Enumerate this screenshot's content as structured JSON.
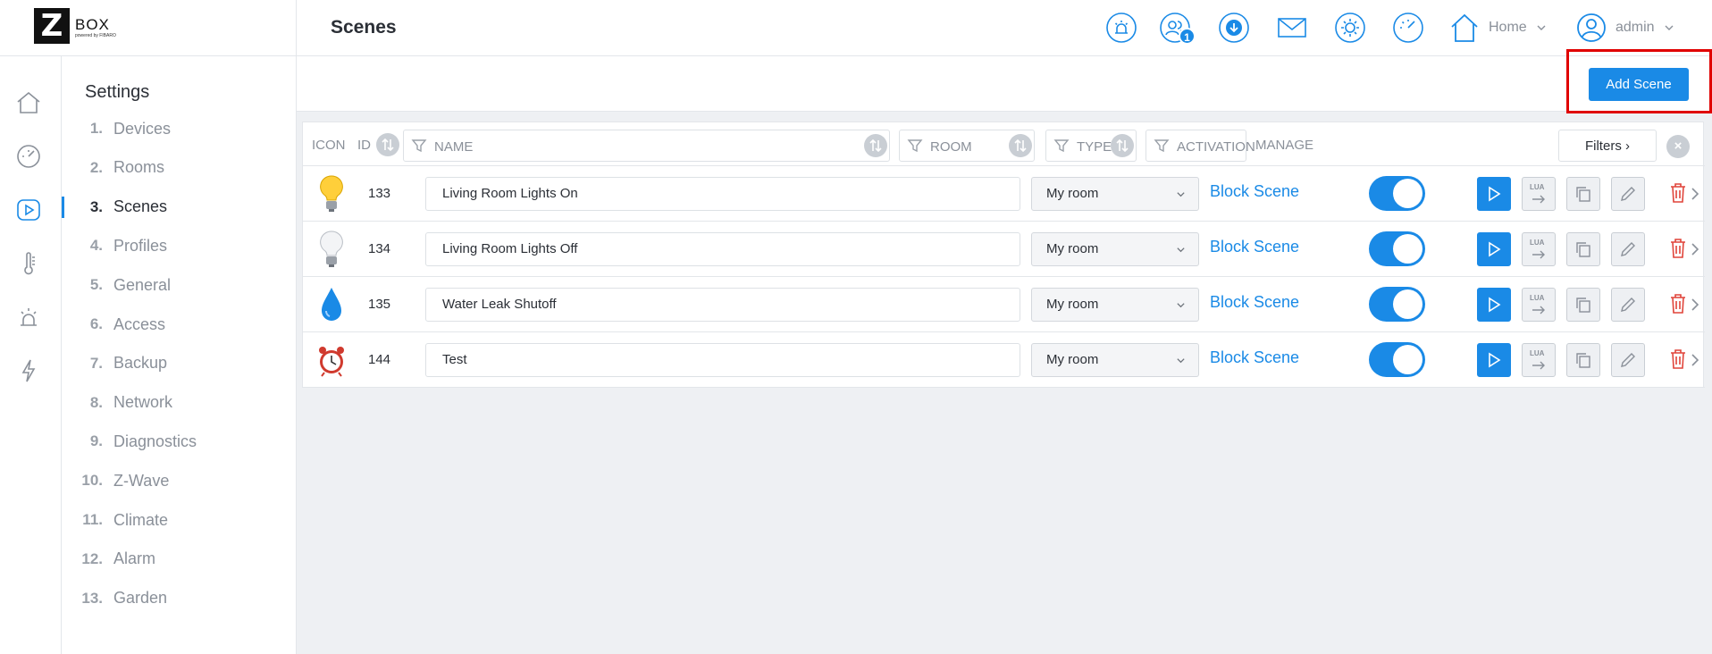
{
  "logo": {
    "letter": "Z",
    "word": "BOX",
    "sub": "powered by FIBARO"
  },
  "header": {
    "title": "Scenes",
    "icons": [
      "alarm-icon",
      "users-icon",
      "download-icon",
      "mail-icon",
      "sun-icon",
      "gauge-icon"
    ],
    "users_badge": "1",
    "home_label": "Home",
    "user_label": "admin"
  },
  "rail": {
    "icons": [
      "home-icon",
      "gauge-icon",
      "play-icon",
      "thermometer-icon",
      "alarm-icon",
      "bolt-icon"
    ]
  },
  "settings": {
    "title": "Settings",
    "items": [
      {
        "num": "1.",
        "label": "Devices"
      },
      {
        "num": "2.",
        "label": "Rooms"
      },
      {
        "num": "3.",
        "label": "Scenes"
      },
      {
        "num": "4.",
        "label": "Profiles"
      },
      {
        "num": "5.",
        "label": "General"
      },
      {
        "num": "6.",
        "label": "Access"
      },
      {
        "num": "7.",
        "label": "Backup"
      },
      {
        "num": "8.",
        "label": "Network"
      },
      {
        "num": "9.",
        "label": "Diagnostics"
      },
      {
        "num": "10.",
        "label": "Z-Wave"
      },
      {
        "num": "11.",
        "label": "Climate"
      },
      {
        "num": "12.",
        "label": "Alarm"
      },
      {
        "num": "13.",
        "label": "Garden"
      }
    ],
    "active_index": 2
  },
  "toolbar": {
    "add_label": "Add Scene"
  },
  "table": {
    "headers": {
      "icon": "ICON",
      "id": "ID",
      "name": "NAME",
      "room": "ROOM",
      "type": "TYPE",
      "activation": "ACTIVATION",
      "manage": "MANAGE",
      "filters": "Filters",
      "clear": "×"
    },
    "lua_label": "LUA",
    "rows": [
      {
        "icon": "bulb-on-icon",
        "id": "133",
        "name": "Living Room Lights On",
        "room": "My room",
        "type": "Block Scene",
        "active": true
      },
      {
        "icon": "bulb-off-icon",
        "id": "134",
        "name": "Living Room Lights Off",
        "room": "My room",
        "type": "Block Scene",
        "active": true
      },
      {
        "icon": "water-drop-icon",
        "id": "135",
        "name": "Water Leak Shutoff",
        "room": "My room",
        "type": "Block Scene",
        "active": true
      },
      {
        "icon": "alarm-clock-icon",
        "id": "144",
        "name": "Test",
        "room": "My room",
        "type": "Block Scene",
        "active": true
      }
    ]
  },
  "colors": {
    "accent": "#1a8ae6",
    "highlight": "#e00000",
    "delete": "#e0443a"
  }
}
